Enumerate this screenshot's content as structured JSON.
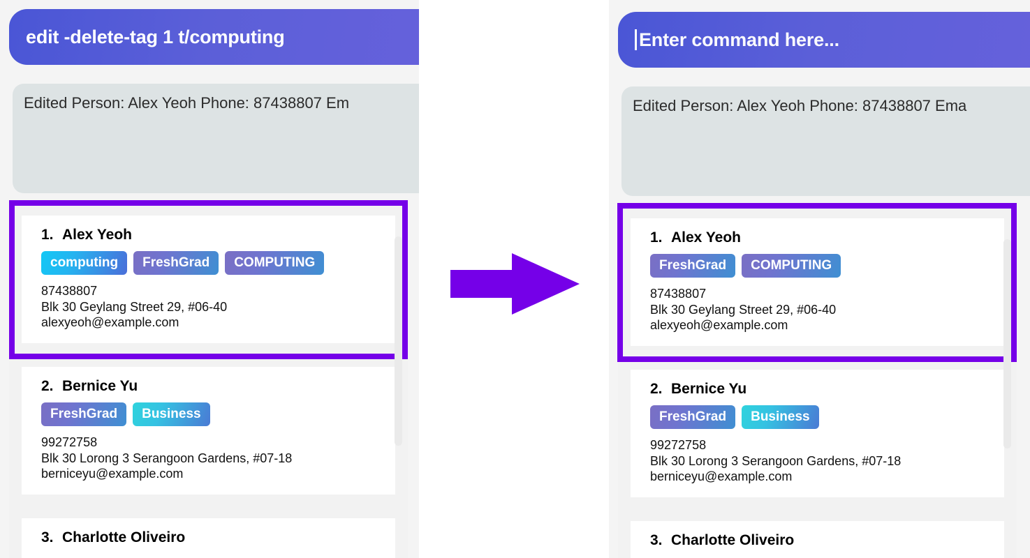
{
  "arrow": {
    "icon": "right-arrow-icon",
    "color": "#7500e8"
  },
  "highlight": {
    "color": "#7500e8",
    "note": "first person card"
  },
  "panels": [
    {
      "id": "before",
      "command_bar": {
        "value": "edit -delete-tag 1 t/computing",
        "placeholder": "Enter command here...",
        "show_caret": false,
        "accent": "#5257d7"
      },
      "result_box": {
        "text": "Edited Person: Alex Yeoh Phone: 87438807 Em",
        "background": "#dde3e4"
      },
      "people": [
        {
          "index": "1.",
          "name": "Alex Yeoh",
          "tags": [
            {
              "label": "computing",
              "style": "cyan"
            },
            {
              "label": "FreshGrad",
              "style": "purple"
            },
            {
              "label": "COMPUTING",
              "style": "purple"
            }
          ],
          "phone": "87438807",
          "address": "Blk 30 Geylang Street 29, #06-40",
          "email": "alexyeoh@example.com",
          "highlighted": true
        },
        {
          "index": "2.",
          "name": "Bernice Yu",
          "tags": [
            {
              "label": "FreshGrad",
              "style": "purple"
            },
            {
              "label": "Business",
              "style": "teal"
            }
          ],
          "phone": "99272758",
          "address": "Blk 30 Lorong 3 Serangoon Gardens, #07-18",
          "email": "berniceyu@example.com",
          "highlighted": false
        },
        {
          "index": "3.",
          "name": "Charlotte Oliveiro",
          "tags": [],
          "phone": "",
          "address": "",
          "email": "",
          "highlighted": false
        }
      ]
    },
    {
      "id": "after",
      "command_bar": {
        "value": "",
        "placeholder": "Enter command here...",
        "show_caret": true,
        "accent": "#5257d7"
      },
      "result_box": {
        "text": "Edited Person: Alex Yeoh Phone: 87438807 Ema",
        "background": "#dde3e4"
      },
      "people": [
        {
          "index": "1.",
          "name": "Alex Yeoh",
          "tags": [
            {
              "label": "FreshGrad",
              "style": "purple"
            },
            {
              "label": "COMPUTING",
              "style": "purple"
            }
          ],
          "phone": "87438807",
          "address": "Blk 30 Geylang Street 29, #06-40",
          "email": "alexyeoh@example.com",
          "highlighted": true
        },
        {
          "index": "2.",
          "name": "Bernice Yu",
          "tags": [
            {
              "label": "FreshGrad",
              "style": "purple"
            },
            {
              "label": "Business",
              "style": "teal"
            }
          ],
          "phone": "99272758",
          "address": "Blk 30 Lorong 3 Serangoon Gardens, #07-18",
          "email": "berniceyu@example.com",
          "highlighted": false
        },
        {
          "index": "3.",
          "name": "Charlotte Oliveiro",
          "tags": [],
          "phone": "",
          "address": "",
          "email": "",
          "highlighted": false
        }
      ]
    }
  ]
}
